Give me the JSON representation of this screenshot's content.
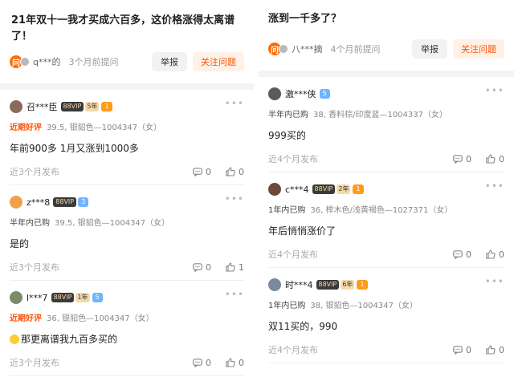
{
  "left": {
    "question": "21年双十一我才买成六百多，这价格涨得太离谱了！",
    "asker": "q***的",
    "ask_badge": "问",
    "ask_time": "3个月前提问",
    "report": "举报",
    "follow": "关注问题",
    "answers": [
      {
        "user": "召***臣",
        "vip": "88VIP",
        "vip_year": "5年",
        "level": "1",
        "level_style": "gold",
        "tag": "近期好评",
        "sku": "39.5, 银貂色—1004347（女）",
        "text": "年前900多 1月又涨到1000多",
        "date": "近3个月发布",
        "comments": "0",
        "likes": "0"
      },
      {
        "user": "z***8",
        "vip": "88VIP",
        "vip_year": "",
        "level": "3",
        "level_style": "blue",
        "tag": "半年内已购",
        "sku": "39.5, 银貂色—1004347（女）",
        "text": "是的",
        "date": "近3个月发布",
        "comments": "0",
        "likes": "1"
      },
      {
        "user": "l***7",
        "vip": "88VIP",
        "vip_year": "1年",
        "level": "5",
        "level_style": "blue",
        "tag": "近期好评",
        "sku": "36, 银貂色—1004347（女）",
        "text": "那更离谱我九百多买的",
        "date": "近3个月发布",
        "comments": "0",
        "likes": "0"
      }
    ]
  },
  "right": {
    "question": "涨到一千多了？",
    "asker": "八***摘",
    "ask_badge": "问",
    "ask_time": "4个月前提问",
    "report": "举报",
    "follow": "关注问题",
    "answers": [
      {
        "user": "激***侠",
        "vip": "",
        "vip_year": "",
        "level": "5",
        "level_style": "blue",
        "tag": "半年内已购",
        "sku": "38, 香料棕/印度蓝—1004337（女）",
        "text": "999买的",
        "date": "近4个月发布",
        "comments": "0",
        "likes": "0"
      },
      {
        "user": "c***4",
        "vip": "88VIP",
        "vip_year": "2年",
        "level": "1",
        "level_style": "gold",
        "tag": "1年内已购",
        "sku": "36, 榉木色/浅黄褐色—1027371（女）",
        "text": "年后悄悄涨价了",
        "date": "近4个月发布",
        "comments": "0",
        "likes": "0"
      },
      {
        "user": "时***4",
        "vip": "88VIP",
        "vip_year": "6年",
        "level": "1",
        "level_style": "gold",
        "tag": "1年内已购",
        "sku": "38, 银貂色—1004347（女）",
        "text": "双11买的，990",
        "date": "近4个月发布",
        "comments": "0",
        "likes": "0"
      }
    ]
  },
  "colors": {
    "accent": "#ff5000",
    "follow_bg": "#fff1e6",
    "gold": "#ff9a1a",
    "blue": "#6fb4ff"
  },
  "icons": {
    "more": "more-dots-icon",
    "comment": "comment-icon",
    "like": "thumbs-up-icon"
  }
}
